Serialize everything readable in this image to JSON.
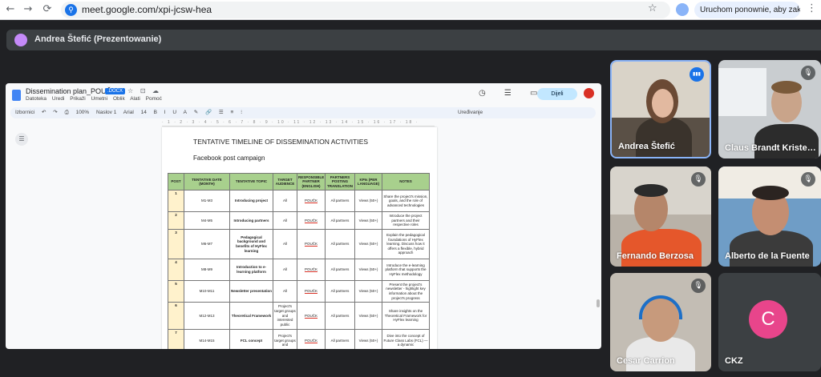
{
  "browser": {
    "back_icon": "←",
    "forward_icon": "→",
    "reload_icon": "⟳",
    "url": "meet.google.com/xpi-jcsw-hea",
    "star_icon": "☆",
    "update_button": "Uruchom ponownie, aby zaktualizować",
    "menu_icon": "⋮"
  },
  "presenter": {
    "label": "Andrea Štefić (Prezentowanie)"
  },
  "doc": {
    "title": "Dissemination plan_POUČK",
    "badge": ".DOCX",
    "title_icons": "☆ ⊡ ☁",
    "menu": [
      "Datoteka",
      "Uredi",
      "Prikaži",
      "Umetni",
      "Oblik",
      "Alati",
      "Pomoć"
    ],
    "share_label": "Dijeli",
    "top_icons": "◷ ☰ ▭",
    "toolbar": [
      "Izbornici",
      "↶",
      "↷",
      "⎙",
      "100%",
      "Naslov 1",
      "Arial",
      "14",
      "B",
      "I",
      "U",
      "A",
      "✎",
      "🔗",
      "☰",
      "≡",
      "⁝"
    ],
    "editing_mode": "Uređivanje",
    "ruler": "· 1 · 2 · 3 · 4 · 5 · 6 · 7 · 8 · 9 · 10 · 11 · 12 · 13 · 14 · 15 · 16 · 17 · 18 ·",
    "heading": "TENTATIVE TIMELINE OF DISSEMINATION ACTIVITIES",
    "subheading": "Facebook post campaign",
    "table": {
      "headers": [
        "POST",
        "TENTATIVE DATE (MONTH)",
        "TENTATIVE TOPIC",
        "TARGET AUDIENCE",
        "RESPONSIBLE PARTNER (ENGLISH)",
        "PARTNERS POSTING TRANSLATION",
        "KPIs (PER LANGUAGE)",
        "NOTES"
      ],
      "rows": [
        {
          "post": "1",
          "date": "M1-M3",
          "topic": "Introducing project",
          "audience": "All",
          "partner": "POUČK",
          "translation": "All partners",
          "kpi": "Views (50+)",
          "notes": "Share the project's mission, goals, and the role of advanced technologies"
        },
        {
          "post": "2",
          "date": "M4-M5",
          "topic": "Introducing partners",
          "audience": "All",
          "partner": "POUČK",
          "translation": "All partners",
          "kpi": "Views (50+)",
          "notes": "Introduce the project partners and their respective roles"
        },
        {
          "post": "3",
          "date": "M6-M7",
          "topic": "Pedagogical background and benefits of HyFlex learning",
          "audience": "All",
          "partner": "POUČK",
          "translation": "All partners",
          "kpi": "Views (50+)",
          "notes": "Explain the pedagogical foundations of HyFlex learning. Discuss how it offers a flexible, hybrid approach"
        },
        {
          "post": "4",
          "date": "M8-M9",
          "topic": "Introduction to e-learning platform",
          "audience": "All",
          "partner": "POUČK",
          "translation": "All partners",
          "kpi": "Views (50+)",
          "notes": "Introduce the e-learning platform that supports the HyFlex methodology"
        },
        {
          "post": "5",
          "date": "M10-M11",
          "topic": "Newsletter presentation",
          "audience": "All",
          "partner": "POUČK",
          "translation": "All partners",
          "kpi": "Views (50+)",
          "notes": "Present the project's newsletter - highlight key information about the project's progress"
        },
        {
          "post": "6",
          "date": "M12-M13",
          "topic": "Theoretical Framework",
          "audience": "Project's target groups and interested public",
          "partner": "POUČK",
          "translation": "All partners",
          "kpi": "Views (50+)",
          "notes": "Share insights on the Theoretical Framework for HyFlex learning"
        },
        {
          "post": "7",
          "date": "M14-M15",
          "topic": "FCL concept",
          "audience": "Project's target groups and",
          "partner": "POUČK",
          "translation": "All partners",
          "kpi": "Views (50+)",
          "notes": "Dive into the concept of Future Class Labs (FCL) — a dynamic"
        }
      ]
    }
  },
  "participants": [
    {
      "name": "Andrea Štefić",
      "mic": "▮▮▮"
    },
    {
      "name": "Claus Brandt Kriste…",
      "mic": "🎙"
    },
    {
      "name": "Fernando Berzosa",
      "mic": "🎙"
    },
    {
      "name": "Alberto de la Fuente",
      "mic": "🎙"
    },
    {
      "name": "Cesar Carrion",
      "mic": "🎙"
    },
    {
      "name": "CKZ",
      "initial": "C"
    }
  ],
  "colors": {
    "meet_background": "#202124",
    "table_header": "#a8d08d",
    "post_column": "#fff2cc",
    "ckz_avatar": "#e8458b",
    "active_speaker_border": "#8ab4f8"
  }
}
